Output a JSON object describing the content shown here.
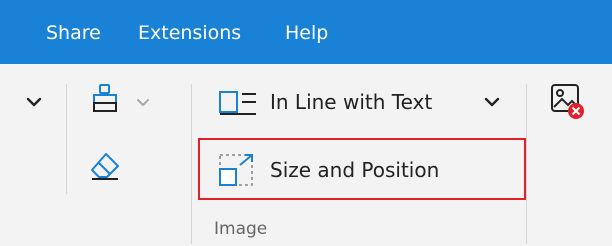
{
  "menubar": {
    "items": [
      {
        "label": "Share"
      },
      {
        "label": "Extensions"
      },
      {
        "label": "Help"
      }
    ]
  },
  "ribbon": {
    "wrap_text_label": "In Line with Text",
    "size_position_label": "Size and Position",
    "group_label": "Image"
  },
  "colors": {
    "menubar_bg": "#1a82d6",
    "accent_blue": "#1a82d6",
    "highlight_red": "#e0212b",
    "badge_red": "#e0212b"
  },
  "icons": {
    "format_painter": "paint-brush-icon",
    "eraser": "eraser-icon",
    "wrap_text": "wrap-text-icon",
    "size_position": "size-position-icon",
    "remove_image": "image-remove-icon"
  }
}
